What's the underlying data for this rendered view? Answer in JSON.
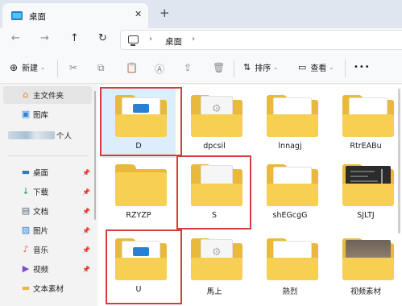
{
  "tab": {
    "title": "桌面",
    "close": "✕",
    "add": "+"
  },
  "nav": {
    "back": "←",
    "forward": "→",
    "up": "↑",
    "refresh": "↻",
    "sep1": "›",
    "location": "桌面",
    "sep2": "›"
  },
  "toolbar": {
    "new_label": "新建",
    "cut": "✂",
    "copy": "⧉",
    "paste": "📋",
    "rename": "Ⓐ",
    "share": "⇪",
    "delete": "🗑",
    "sort_label": "排序",
    "view_label": "查看",
    "more": "•••",
    "chevron": "⌄",
    "new_icon": "⊕",
    "sort_icon": "⇅",
    "view_icon": "▭"
  },
  "sidebar": {
    "items": [
      {
        "label": "主文件夹",
        "icon": "⌂",
        "pinned": false
      },
      {
        "label": "图库",
        "icon": "▣",
        "pinned": false
      },
      {
        "label": "个人",
        "icon": "",
        "pinned": false
      },
      {
        "label": "桌面",
        "icon": "▬",
        "pinned": true
      },
      {
        "label": "下载",
        "icon": "↓",
        "pinned": true
      },
      {
        "label": "文档",
        "icon": "▤",
        "pinned": true
      },
      {
        "label": "图片",
        "icon": "▨",
        "pinned": true
      },
      {
        "label": "音乐",
        "icon": "♪",
        "pinned": true
      },
      {
        "label": "视频",
        "icon": "▶",
        "pinned": true
      },
      {
        "label": "文本素材",
        "icon": "▬",
        "pinned": false
      }
    ],
    "pin": "📌"
  },
  "files": [
    {
      "name": "D"
    },
    {
      "name": "dpcsil"
    },
    {
      "name": "lnnagj"
    },
    {
      "name": "RtrEABu"
    },
    {
      "name": "RZYZP"
    },
    {
      "name": "S"
    },
    {
      "name": "shEGcgG"
    },
    {
      "name": "SJLTJ"
    },
    {
      "name": "U"
    },
    {
      "name": "馬上"
    },
    {
      "name": "熱烈"
    },
    {
      "name": "视频素材"
    }
  ],
  "colors": {
    "highlight": "#d93b3b",
    "folder_back": "#e8b93c",
    "folder_front": "#f7cf52",
    "selection": "#dcedfb"
  }
}
